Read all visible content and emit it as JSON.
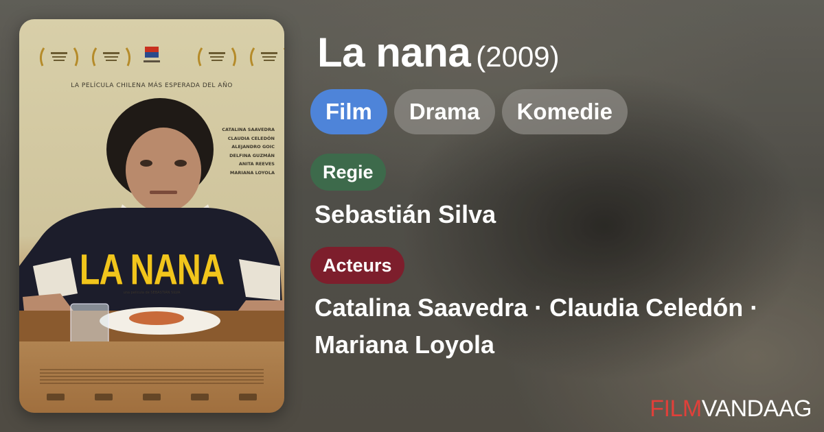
{
  "movie": {
    "title": "La nana",
    "year": "(2009)"
  },
  "tags": [
    "Film",
    "Drama",
    "Komedie"
  ],
  "director": {
    "label": "Regie",
    "names": "Sebastián Silva"
  },
  "cast": {
    "label": "Acteurs",
    "names": "Catalina Saavedra · Claudia Celedón · Mariana Loyola"
  },
  "poster": {
    "tagline": "LA PELÍCULA CHILENA MÁS ESPERADA DEL AÑO",
    "title": "LA NANA",
    "byline": "una película de SEBASTIÁN SILVA",
    "cast": [
      "CATALINA SAAVEDRA",
      "CLAUDIA CELEDÓN",
      "ALEJANDRO GOIC",
      "DELFINA GUZMÁN",
      "ANITA REEVES",
      "MARIANA LOYOLA"
    ]
  },
  "brand": {
    "part1": "FILM",
    "part2": "VANDAAG"
  },
  "colors": {
    "tag_primary": "#4e84d9",
    "tag_secondary": "#8c8a84",
    "regie_badge": "#3d6a4b",
    "acteurs_badge": "#7d1e2c",
    "brand_red": "#e0403a"
  }
}
